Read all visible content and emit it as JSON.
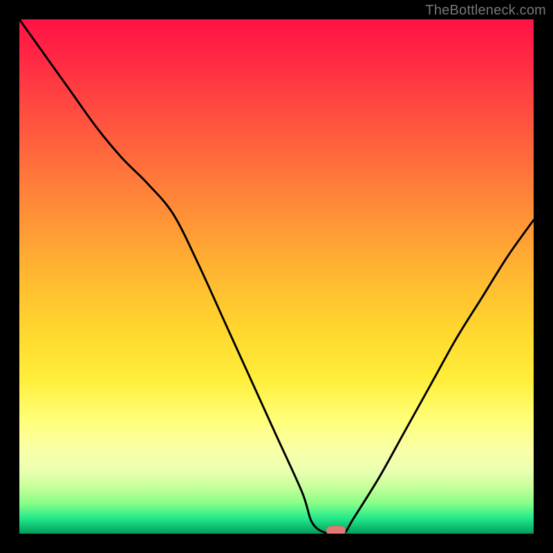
{
  "watermark": "TheBottleneck.com",
  "colors": {
    "background": "#000000",
    "curve_stroke": "#000000",
    "marker_fill": "#e07874",
    "gradient_top": "#ff1245",
    "gradient_bottom": "#009e5b"
  },
  "chart_data": {
    "type": "line",
    "title": "",
    "xlabel": "",
    "ylabel": "",
    "xlim": [
      0,
      100
    ],
    "ylim": [
      0,
      100
    ],
    "grid": false,
    "legend": false,
    "description": "Bottleneck-percentage curve overlaid on a vertical heat gradient from red (high bottleneck) to green (no bottleneck). Minimum sits near x≈60 at y≈0.",
    "series": [
      {
        "name": "bottleneck-curve",
        "x": [
          0,
          5,
          10,
          15,
          20,
          25,
          30,
          35,
          40,
          45,
          50,
          55,
          57,
          60,
          63,
          65,
          70,
          75,
          80,
          85,
          90,
          95,
          100
        ],
        "y": [
          100,
          93,
          86,
          79,
          73,
          68,
          62,
          52,
          41,
          30,
          19,
          8,
          2,
          0,
          0,
          3,
          11,
          20,
          29,
          38,
          46,
          54,
          61
        ]
      }
    ],
    "marker": {
      "x": 61.5,
      "y": 0.5
    }
  }
}
